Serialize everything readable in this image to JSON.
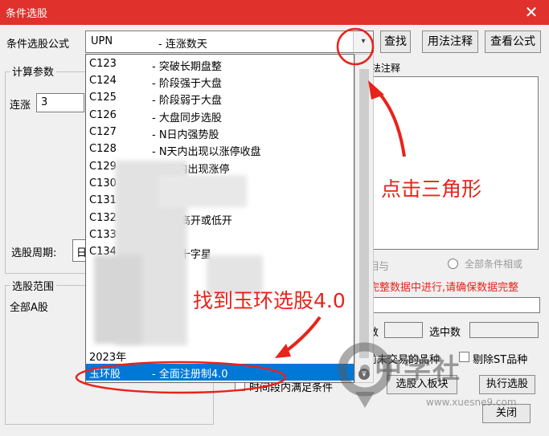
{
  "window": {
    "title": "条件选股",
    "close": "✕"
  },
  "formula": {
    "label": "条件选股公式",
    "code": "UPN",
    "name": "- 连涨数天",
    "arrow": "▾"
  },
  "buttons": {
    "find": "查找",
    "usage": "用法注释",
    "view": "查看公式",
    "add_to_board": "选股入板块",
    "execute": "执行选股",
    "close": "关闭"
  },
  "params": {
    "group": "计算参数",
    "rise_label": "连涨",
    "rise_value": "3"
  },
  "period": {
    "label": "选股周期:",
    "value": "日"
  },
  "range": {
    "group": "选股范围",
    "value": "全部A股"
  },
  "right": {
    "fragment": "用法注释",
    "opt_and_fragment": "相与",
    "opt_all": "全部条件相或",
    "warn": "在完整数据中进行,请确保数据完整",
    "count_label": "数",
    "selected_label": "选中数",
    "untraded": "前未交易的品种",
    "exclude_st": "剔除ST品种",
    "period_cond": "时间段内满足条件"
  },
  "dropdown": {
    "items": [
      {
        "code": "C123",
        "name": "- 突破长期盘整"
      },
      {
        "code": "C124",
        "name": "- 阶段强于大盘"
      },
      {
        "code": "C125",
        "name": "- 阶段弱于大盘"
      },
      {
        "code": "C126",
        "name": "- 大盘同步选股"
      },
      {
        "code": "C127",
        "name": "- N日内强势股"
      },
      {
        "code": "C128",
        "name": "- N天内出现以涨停收盘"
      },
      {
        "code": "C129",
        "name": "- N天内出现涨停"
      },
      {
        "code": "C130",
        "name": ""
      },
      {
        "code": "C131",
        "name": ""
      },
      {
        "code": "C132",
        "name": "- 跳空高开或低开"
      },
      {
        "code": "C133",
        "name": ""
      },
      {
        "code": "C134",
        "name": "- 底部十字星"
      }
    ],
    "extra_code": "2023年",
    "selected": {
      "code": "玉环股",
      "name": "- 全面注册制4.0"
    }
  },
  "annotations": {
    "click_triangle": "点击三角形",
    "find_item": "找到玉环选股4.0"
  },
  "watermark": {
    "text": "中学社",
    "url": "www.xuesne9.com"
  },
  "colors": {
    "title_bar": "#e0312c",
    "annotation": "#e8231b",
    "selection": "#0078d7"
  }
}
